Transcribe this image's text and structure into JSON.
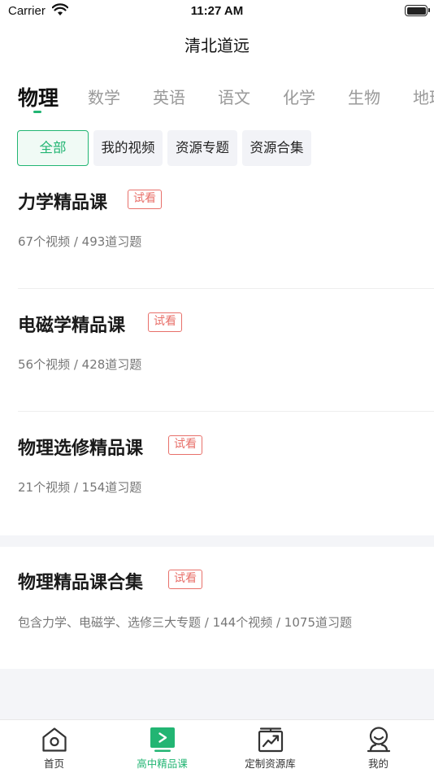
{
  "status_bar": {
    "carrier": "Carrier",
    "time": "11:27 AM"
  },
  "app_title": "清北道远",
  "subject_tabs": [
    "物理",
    "数学",
    "英语",
    "语文",
    "化学",
    "生物",
    "地理"
  ],
  "filter_chips": [
    "全部",
    "我的视频",
    "资源专题",
    "资源合集"
  ],
  "trial_label": "试看",
  "courses": [
    {
      "title": "力学精品课",
      "meta": "67个视频 / 493道习题"
    },
    {
      "title": "电磁学精品课",
      "meta": "56个视频 / 428道习题"
    },
    {
      "title": "物理选修精品课",
      "meta": "21个视频 / 154道习题"
    },
    {
      "title": "物理精品课合集",
      "meta": "包含力学、电磁学、选修三大专题 / 144个视频 / 1075道习题"
    }
  ],
  "bottom_nav": [
    {
      "label": "首页",
      "icon": "home-icon"
    },
    {
      "label": "高中精品课",
      "icon": "play-icon"
    },
    {
      "label": "定制资源库",
      "icon": "chart-board-icon"
    },
    {
      "label": "我的",
      "icon": "profile-icon"
    }
  ],
  "colors": {
    "accent": "#22b573",
    "trial": "#e8706a",
    "chip_bg": "#f2f3f7",
    "section_bg": "#f4f5f8"
  }
}
